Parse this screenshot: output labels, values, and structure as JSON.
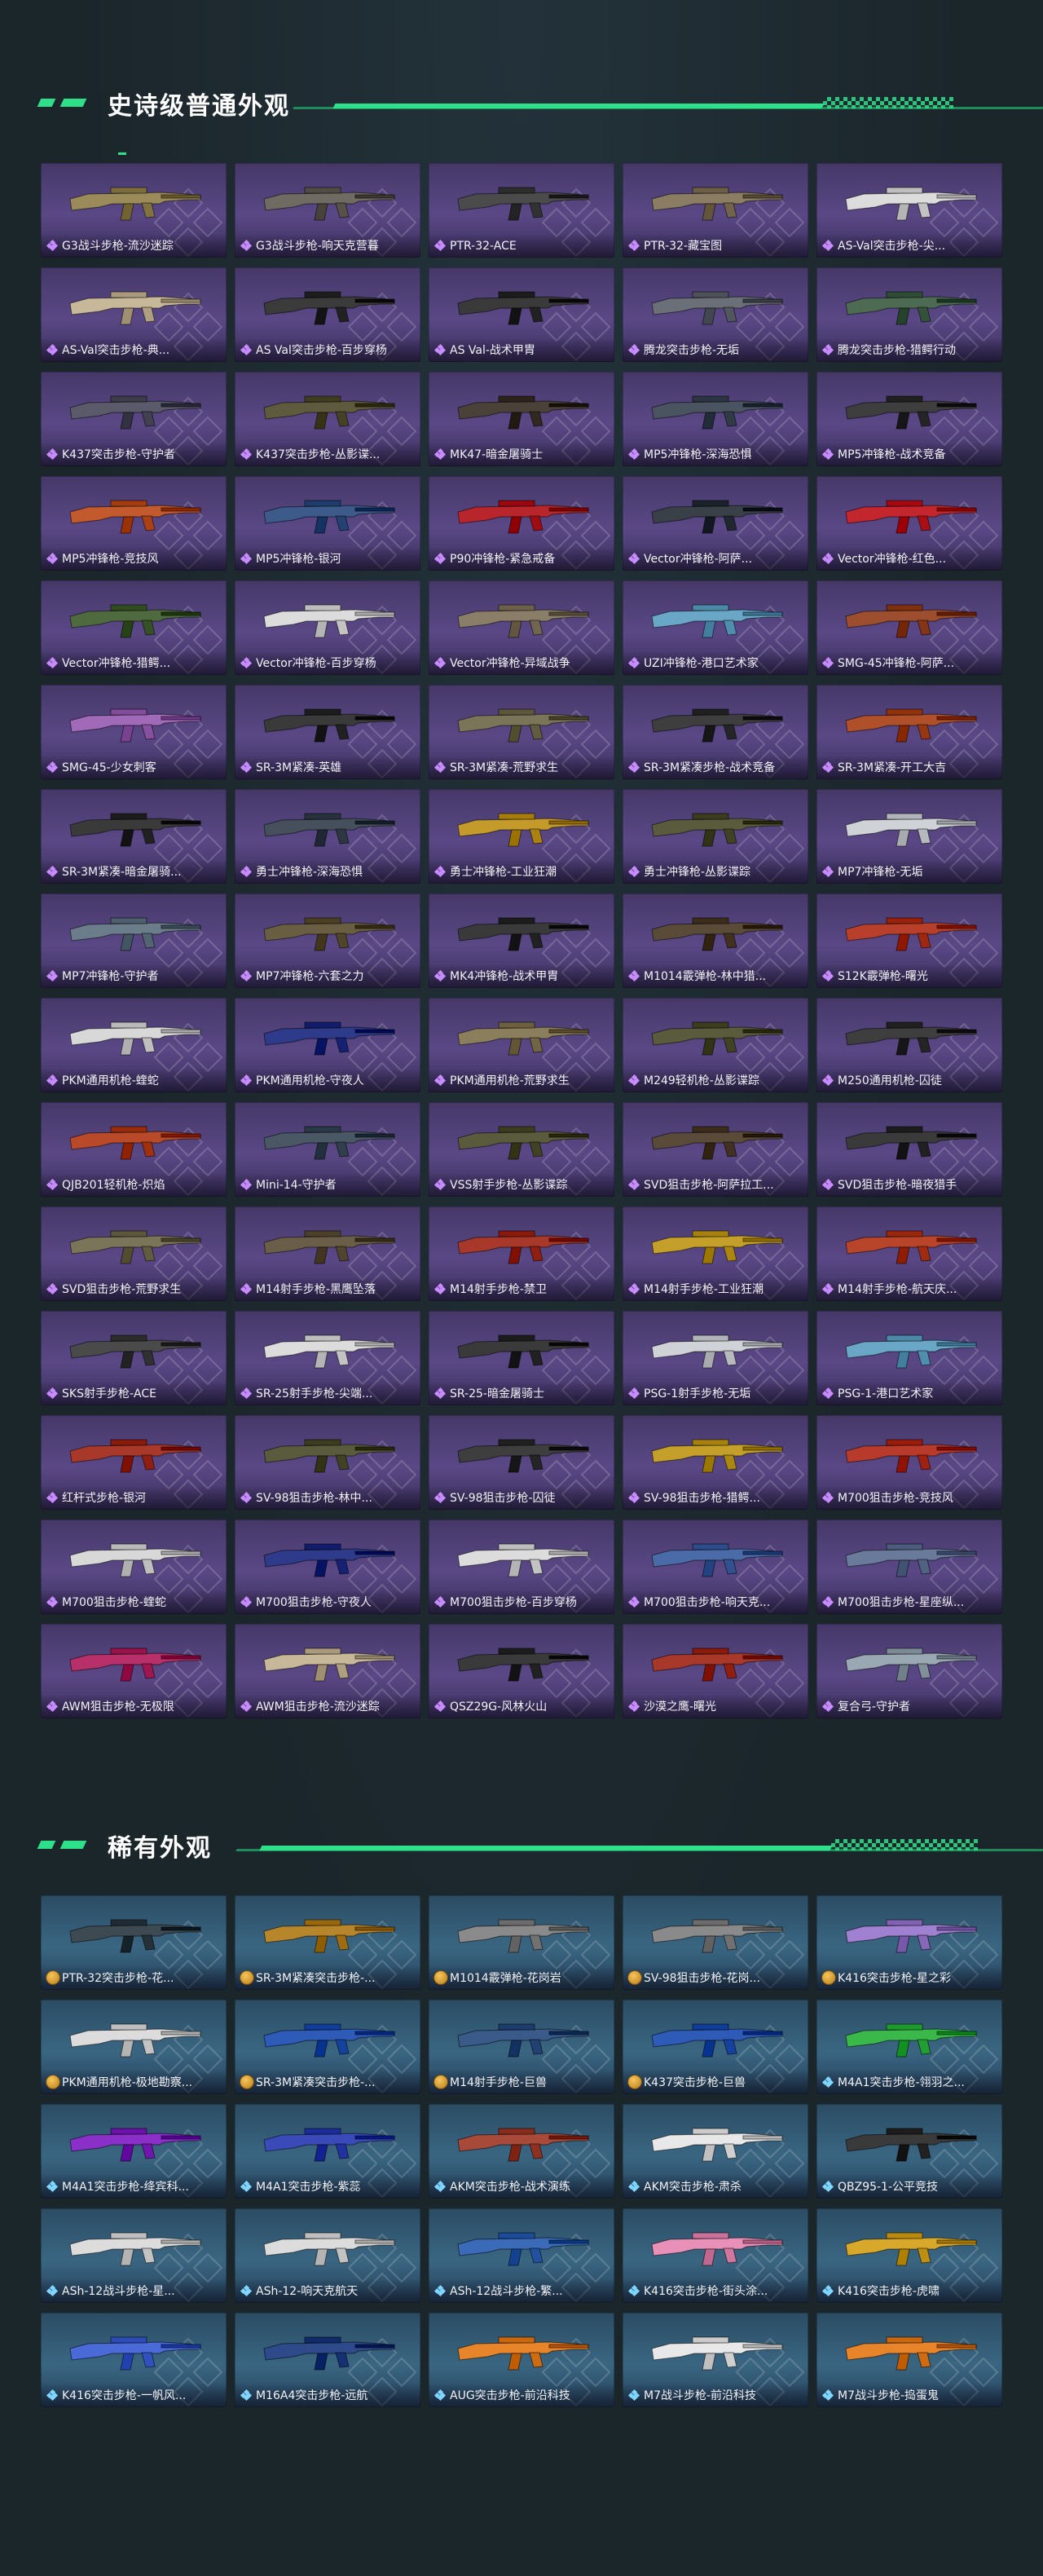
{
  "sections": {
    "epic": {
      "title": "史诗级普通外观",
      "items": [
        {
          "label": "G3战斗步枪-流沙迷踪",
          "color": "#9c8b5a"
        },
        {
          "label": "G3战斗步枪-响天克营暮",
          "color": "#6f6a62"
        },
        {
          "label": "PTR-32-ACE",
          "color": "#4b4b4b"
        },
        {
          "label": "PTR-32-藏宝图",
          "color": "#8b7d63"
        },
        {
          "label": "AS-Val突击步枪-尖...",
          "color": "#dcdcdc"
        },
        {
          "label": "AS-Val突击步枪-典...",
          "color": "#c8b89a"
        },
        {
          "label": "AS Val突击步枪-百步穿杨",
          "color": "#3b3b3b"
        },
        {
          "label": "AS Val-战术甲胄",
          "color": "#3a3a3a"
        },
        {
          "label": "腾龙突击步枪-无垢",
          "color": "#6a6f78"
        },
        {
          "label": "腾龙突击步枪-猎鳄行动",
          "color": "#4d6b52"
        },
        {
          "label": "K437突击步枪-守护者",
          "color": "#5a5a6a"
        },
        {
          "label": "K437突击步枪-丛影谍...",
          "color": "#5e5a3e"
        },
        {
          "label": "MK47-暗金屠骑士",
          "color": "#4a4238"
        },
        {
          "label": "MP5冲锋枪-深海恐惧",
          "color": "#4a5360"
        },
        {
          "label": "MP5冲锋枪-战术竞备",
          "color": "#3e3e3e"
        },
        {
          "label": "MP5冲锋枪-竞技风",
          "color": "#c35a2e"
        },
        {
          "label": "MP5冲锋枪-银河",
          "color": "#3c5a8a"
        },
        {
          "label": "P90冲锋枪-紧急戒备",
          "color": "#b8262b"
        },
        {
          "label": "Vector冲锋枪-阿萨...",
          "color": "#3a4048"
        },
        {
          "label": "Vector冲锋枪-红色...",
          "color": "#c4262e"
        },
        {
          "label": "Vector冲锋枪-猎鳄...",
          "color": "#4f6a3e"
        },
        {
          "label": "Vector冲锋枪-百步穿杨",
          "color": "#dcdcdc"
        },
        {
          "label": "Vector冲锋枪-异域战争",
          "color": "#8a7e68"
        },
        {
          "label": "UZI冲锋枪-港口艺术家",
          "color": "#6aa7c6"
        },
        {
          "label": "SMG-45冲锋枪-阿萨...",
          "color": "#9c4e2e"
        },
        {
          "label": "SMG-45-少女刺客",
          "color": "#a06ab8"
        },
        {
          "label": "SR-3M紧凑-英雄",
          "color": "#3a3a3a"
        },
        {
          "label": "SR-3M紧凑-荒野求生",
          "color": "#7a7458"
        },
        {
          "label": "SR-3M紧凑步枪-战术竞备",
          "color": "#3e3e3e"
        },
        {
          "label": "SR-3M紧凑-开工大吉",
          "color": "#b0502a"
        },
        {
          "label": "SR-3M紧凑-暗金屠骑...",
          "color": "#3a3a3a"
        },
        {
          "label": "勇士冲锋枪-深海恐惧",
          "color": "#46505c"
        },
        {
          "label": "勇士冲锋枪-工业狂潮",
          "color": "#c49a2a"
        },
        {
          "label": "勇士冲锋枪-丛影谍踪",
          "color": "#5a5a3c"
        },
        {
          "label": "MP7冲锋枪-无垢",
          "color": "#cfd3d8"
        },
        {
          "label": "MP7冲锋枪-守护者",
          "color": "#6b7c8a"
        },
        {
          "label": "MP7冲锋枪-六套之力",
          "color": "#6a5e42"
        },
        {
          "label": "MK4冲锋枪-战术甲胄",
          "color": "#3a3a3a"
        },
        {
          "label": "M1014霰弹枪-林中猎...",
          "color": "#5a4a38"
        },
        {
          "label": "S12K霰弹枪-曙光",
          "color": "#b8402a"
        },
        {
          "label": "PKM通用机枪-蝰蛇",
          "color": "#d8d8d8"
        },
        {
          "label": "PKM通用机枪-守夜人",
          "color": "#2e3a8a"
        },
        {
          "label": "PKM通用机枪-荒野求生",
          "color": "#8a7e5c"
        },
        {
          "label": "M249轻机枪-丛影谍踪",
          "color": "#5a5a3c"
        },
        {
          "label": "M250通用机枪-囚徒",
          "color": "#3e3e3e"
        },
        {
          "label": "QJB201轻机枪-炽焰",
          "color": "#b84a2a"
        },
        {
          "label": "Mini-14-守护者",
          "color": "#4a5866"
        },
        {
          "label": "VSS射手步枪-丛影谍踪",
          "color": "#5a5a3c"
        },
        {
          "label": "SVD狙击步枪-阿萨拉工...",
          "color": "#5a4a3a"
        },
        {
          "label": "SVD狙击步枪-暗夜猎手",
          "color": "#3a3a3a"
        },
        {
          "label": "SVD狙击步枪-荒野求生",
          "color": "#7a7458"
        },
        {
          "label": "M14射手步枪-黑鹰坠落",
          "color": "#6a5e48"
        },
        {
          "label": "M14射手步枪-禁卫",
          "color": "#a8382a"
        },
        {
          "label": "M14射手步枪-工业狂潮",
          "color": "#c4a02a"
        },
        {
          "label": "M14射手步枪-航天庆...",
          "color": "#b8452a"
        },
        {
          "label": "SKS射手步枪-ACE",
          "color": "#4a4a4a"
        },
        {
          "label": "SR-25射手步枪-尖端...",
          "color": "#dcdcdc"
        },
        {
          "label": "SR-25-暗金屠骑士",
          "color": "#3a3a3a"
        },
        {
          "label": "PSG-1射手步枪-无垢",
          "color": "#cfd3d8"
        },
        {
          "label": "PSG-1-港口艺术家",
          "color": "#6aa7c6"
        },
        {
          "label": "红杆式步枪-银河",
          "color": "#a8382a"
        },
        {
          "label": "SV-98狙击步枪-林中...",
          "color": "#5a5a3c"
        },
        {
          "label": "SV-98狙击步枪-囚徒",
          "color": "#3e3e3e"
        },
        {
          "label": "SV-98狙击步枪-猎鳄...",
          "color": "#c4a02a"
        },
        {
          "label": "M700狙击步枪-竞技风",
          "color": "#b83a2a"
        },
        {
          "label": "M700狙击步枪-蝰蛇",
          "color": "#d8d8d8"
        },
        {
          "label": "M700狙击步枪-守夜人",
          "color": "#2e3a8a"
        },
        {
          "label": "M700狙击步枪-百步穿杨",
          "color": "#dcdcdc"
        },
        {
          "label": "M700狙击步枪-响天克...",
          "color": "#4a6aa8"
        },
        {
          "label": "M700狙击步枪-星座纵...",
          "color": "#6a7a9a"
        },
        {
          "label": "AWM狙击步枪-无极限",
          "color": "#b8306a"
        },
        {
          "label": "AWM狙击步枪-流沙迷踪",
          "color": "#c8b89a"
        },
        {
          "label": "QSZ29G-风林火山",
          "color": "#3a3a3a"
        },
        {
          "label": "沙漠之鹰-曙光",
          "color": "#a8382a"
        },
        {
          "label": "复合弓-守护者",
          "color": "#9aa8b4"
        }
      ]
    },
    "rare": {
      "title": "稀有外观",
      "items": [
        {
          "label": "PTR-32突击步枪-花...",
          "color": "#3e4a52",
          "marker": "coin"
        },
        {
          "label": "SR-3M紧凑突击步枪-...",
          "color": "#b8862a",
          "marker": "coin"
        },
        {
          "label": "M1014霰弹枪-花岗岩",
          "color": "#8a8a8a",
          "marker": "coin"
        },
        {
          "label": "SV-98狙击步枪-花岗...",
          "color": "#8a8a8a",
          "marker": "coin"
        },
        {
          "label": "K416突击步枪-星之彩",
          "color": "#a080d0",
          "marker": "coin"
        },
        {
          "label": "PKM通用机枪-极地勘察...",
          "color": "#dcdcdc",
          "marker": "coin"
        },
        {
          "label": "SR-3M紧凑突击步枪-...",
          "color": "#2e5ab8",
          "marker": "coin"
        },
        {
          "label": "M14射手步枪-巨兽",
          "color": "#3a5a8a",
          "marker": "coin"
        },
        {
          "label": "K437突击步枪-巨兽",
          "color": "#2e5ab8",
          "marker": "coin"
        },
        {
          "label": "M4A1突击步枪-翎羽之...",
          "color": "#3ab84a",
          "marker": "gem"
        },
        {
          "label": "M4A1突击步枪-绛宾科...",
          "color": "#8a30c8",
          "marker": "gem"
        },
        {
          "label": "M4A1突击步枪-紫蕊",
          "color": "#3a4ab8",
          "marker": "gem"
        },
        {
          "label": "AKM突击步枪-战术演练",
          "color": "#a84a3a",
          "marker": "gem"
        },
        {
          "label": "AKM突击步枪-肃杀",
          "color": "#e8e8e8",
          "marker": "gem"
        },
        {
          "label": "QBZ95-1-公平竞技",
          "color": "#3a3a3a",
          "marker": "gem"
        },
        {
          "label": "ASh-12战斗步枪-星...",
          "color": "#dcdcdc",
          "marker": "gem"
        },
        {
          "label": "ASh-12-响天克航天",
          "color": "#dcdcdc",
          "marker": "gem"
        },
        {
          "label": "ASh-12战斗步枪-繁...",
          "color": "#3a6ab8",
          "marker": "gem"
        },
        {
          "label": "K416突击步枪-街头涂...",
          "color": "#e890b8",
          "marker": "gem"
        },
        {
          "label": "K416突击步枪-虎啸",
          "color": "#d8a82a",
          "marker": "gem"
        },
        {
          "label": "K416突击步枪-一帆风...",
          "color": "#4a6ad8",
          "marker": "gem"
        },
        {
          "label": "M16A4突击步枪-远航",
          "color": "#2e4a8a",
          "marker": "gem"
        },
        {
          "label": "AUG突击步枪-前沿科技",
          "color": "#e8842a",
          "marker": "gem"
        },
        {
          "label": "M7战斗步枪-前沿科技",
          "color": "#e8e8e8",
          "marker": "gem"
        },
        {
          "label": "M7战斗步枪-捣蛋鬼",
          "color": "#e8842a",
          "marker": "gem"
        }
      ]
    }
  }
}
